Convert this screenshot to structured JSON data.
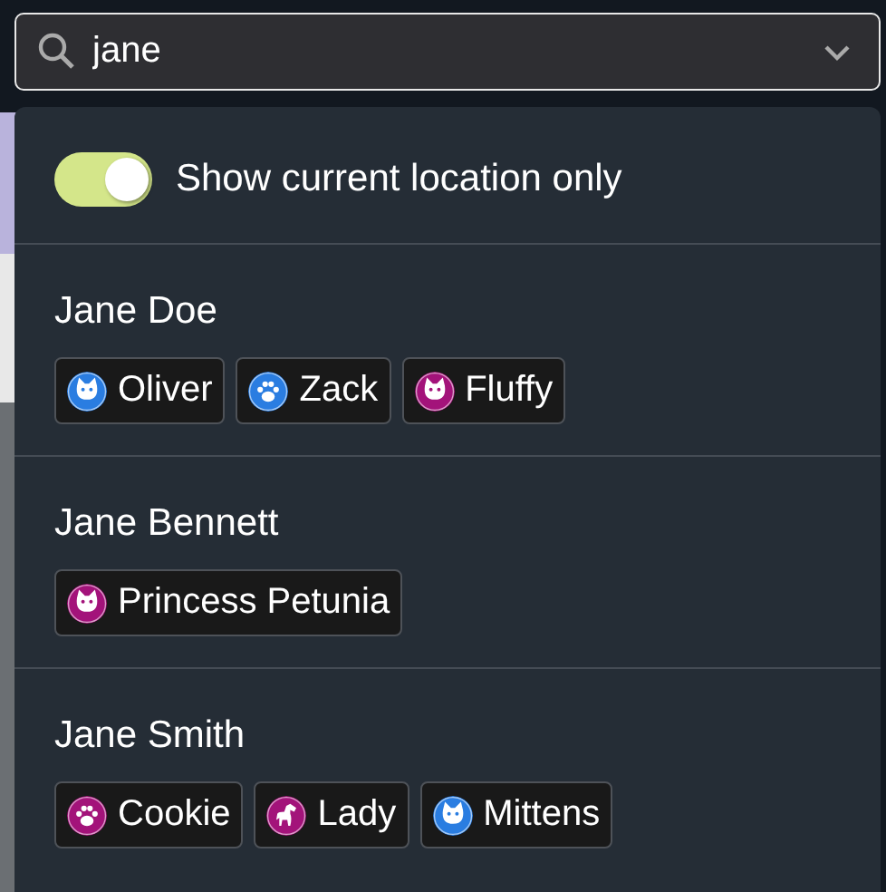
{
  "search": {
    "value": "jane"
  },
  "location_filter": {
    "label": "Show current location only",
    "on": true
  },
  "owners": [
    {
      "name": "Jane Doe",
      "pets": [
        {
          "name": "Oliver",
          "kind": "cat",
          "color": "#2a7de1"
        },
        {
          "name": "Zack",
          "kind": "dog",
          "color": "#2a7de1"
        },
        {
          "name": "Fluffy",
          "kind": "cat",
          "color": "#a3137a"
        }
      ]
    },
    {
      "name": "Jane Bennett",
      "pets": [
        {
          "name": "Princess Petunia",
          "kind": "cat",
          "color": "#a3137a"
        }
      ]
    },
    {
      "name": "Jane Smith",
      "pets": [
        {
          "name": "Cookie",
          "kind": "dog",
          "color": "#a3137a"
        },
        {
          "name": "Lady",
          "kind": "horse",
          "color": "#a3137a"
        },
        {
          "name": "Mittens",
          "kind": "cat",
          "color": "#2a7de1"
        }
      ]
    }
  ]
}
